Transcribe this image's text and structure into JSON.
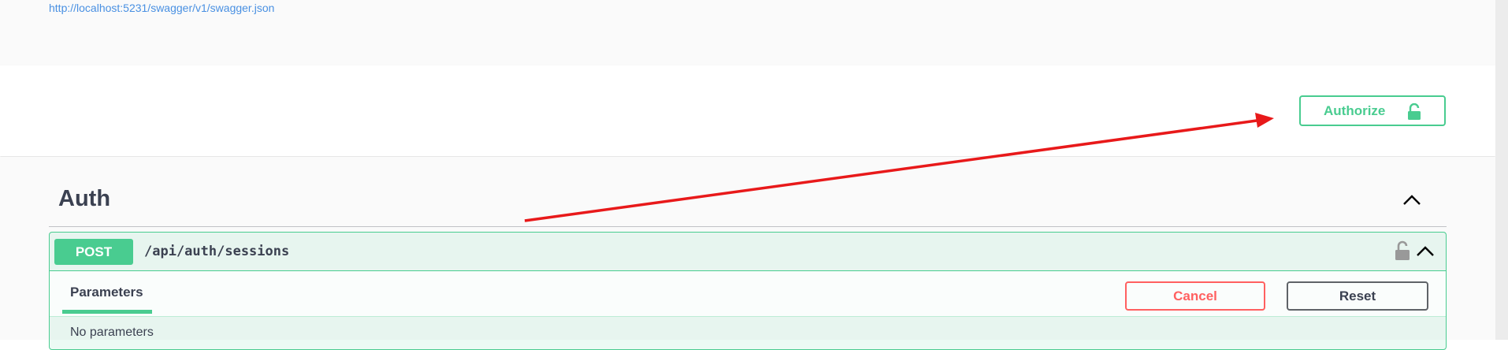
{
  "info": {
    "spec_url": "http://localhost:5231/swagger/v1/swagger.json"
  },
  "auth": {
    "authorize_label": "Authorize",
    "icon": "unlocked-icon"
  },
  "tag": {
    "name": "Auth",
    "expanded": true
  },
  "operation": {
    "method": "POST",
    "path": "/api/auth/sessions",
    "expanded": true,
    "auth_icon": "unlocked-icon",
    "tabs": [
      {
        "label": "Parameters",
        "active": true
      }
    ],
    "cancel_label": "Cancel",
    "reset_label": "Reset",
    "params_text": "No parameters"
  },
  "annotation": {
    "type": "arrow",
    "color": "#e8191a",
    "points_to": "authorize-button"
  },
  "colors": {
    "accent_green": "#49cc90",
    "link_blue": "#4990e2",
    "danger_red": "#ff6060",
    "text": "#3b4151"
  }
}
